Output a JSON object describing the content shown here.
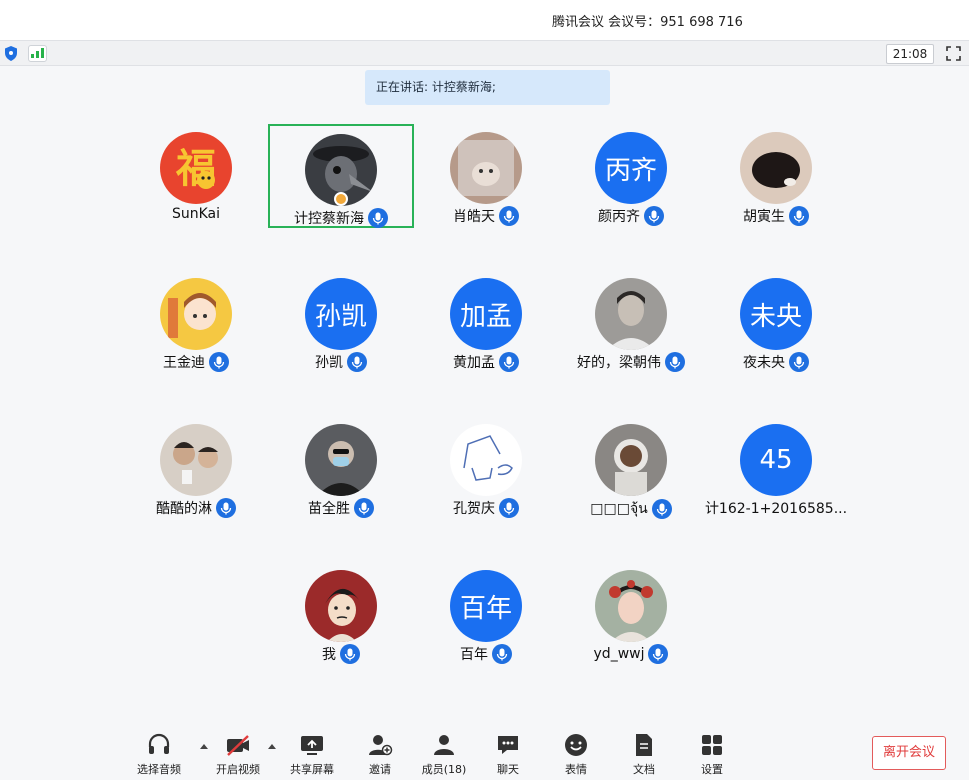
{
  "titlebar": {
    "text": "腾讯会议  会议号：951 698 716"
  },
  "status": {
    "timer": "21:08"
  },
  "banner": {
    "text": "正在讲话: 计控蔡新海;"
  },
  "participants": [
    {
      "name": "SunKai",
      "avatar_text": "",
      "avatar_kind": "fu-icon",
      "mic": false,
      "active": false
    },
    {
      "name": "计控蔡新海",
      "avatar_text": "",
      "avatar_kind": "plague-mask-icon",
      "mic": true,
      "active": true,
      "host": true
    },
    {
      "name": "肖皓天",
      "avatar_text": "",
      "avatar_kind": "hamster-photo",
      "mic": true,
      "active": false
    },
    {
      "name": "颜丙齐",
      "avatar_text": "丙齐",
      "avatar_kind": "text",
      "mic": true,
      "active": false
    },
    {
      "name": "胡寅生",
      "avatar_text": "",
      "avatar_kind": "cat-photo",
      "mic": true,
      "active": false
    },
    {
      "name": "王金迪",
      "avatar_text": "",
      "avatar_kind": "cartoon-girl-icon",
      "mic": true,
      "active": false
    },
    {
      "name": "孙凯",
      "avatar_text": "孙凯",
      "avatar_kind": "text",
      "mic": true,
      "active": false
    },
    {
      "name": "黄加孟",
      "avatar_text": "加孟",
      "avatar_kind": "text",
      "mic": true,
      "active": false
    },
    {
      "name": "好的，梁朝伟",
      "avatar_text": "",
      "avatar_kind": "man-photo",
      "mic": true,
      "active": false
    },
    {
      "name": "夜未央",
      "avatar_text": "未央",
      "avatar_kind": "text",
      "mic": true,
      "active": false
    },
    {
      "name": "酷酷的淋",
      "avatar_text": "",
      "avatar_kind": "two-people-photo",
      "mic": true,
      "active": false
    },
    {
      "name": "苗全胜",
      "avatar_text": "",
      "avatar_kind": "masked-man-photo",
      "mic": true,
      "active": false
    },
    {
      "name": "孔贺庆",
      "avatar_text": "",
      "avatar_kind": "sketch-drawing",
      "mic": true,
      "active": false
    },
    {
      "name": "□□□จุ้น",
      "avatar_text": "",
      "avatar_kind": "astronaut-photo",
      "mic": true,
      "active": false
    },
    {
      "name": "计162-1+2016585...",
      "avatar_text": "45",
      "avatar_kind": "text",
      "mic": false,
      "active": false
    },
    {
      "name": "我",
      "avatar_text": "",
      "avatar_kind": "cartoon-boy-icon",
      "mic": true,
      "active": false
    },
    {
      "name": "百年",
      "avatar_text": "百年",
      "avatar_kind": "text",
      "mic": true,
      "active": false
    },
    {
      "name": "yd_wwj",
      "avatar_text": "",
      "avatar_kind": "opera-lady-photo",
      "mic": true,
      "active": false
    }
  ],
  "toolbar": {
    "audio": "选择音频",
    "video": "开启视频",
    "share": "共享屏幕",
    "invite": "邀请",
    "members": "成员(18)",
    "chat": "聊天",
    "emoji": "表情",
    "docs": "文档",
    "settings": "设置",
    "leave": "离开会议"
  },
  "colors": {
    "accent": "#1a6ff1",
    "active_border": "#29b258",
    "leave": "#e03c3c"
  }
}
